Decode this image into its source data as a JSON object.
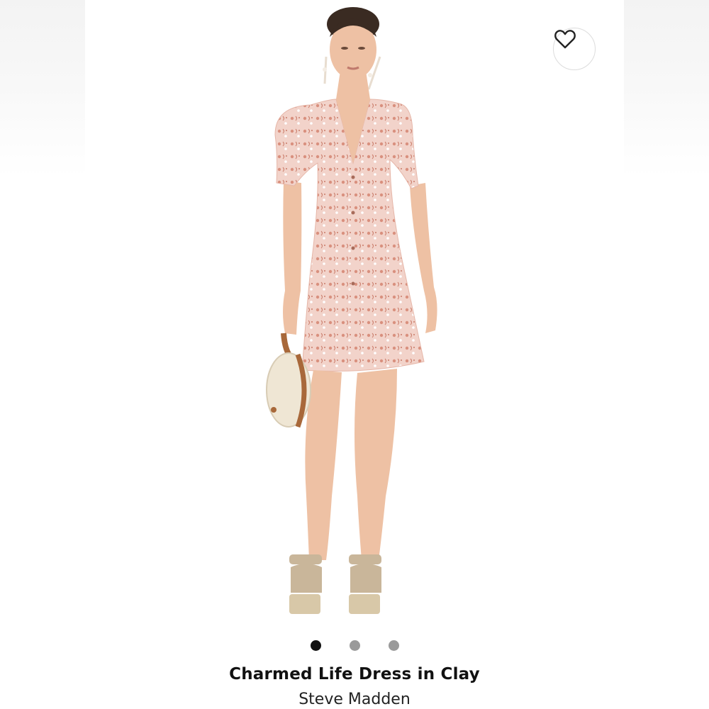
{
  "product": {
    "name": "Charmed Life Dress in Clay",
    "brand": "Steve Madden",
    "favorite_icon": "heart-outline-icon"
  },
  "gallery": {
    "image_count": 3,
    "active_index": 0
  },
  "colors": {
    "dress": "#f0cdc3",
    "skin": "#efc2a6",
    "bag": "#efe6d4",
    "bag_strap": "#a8683a",
    "active_dot": "#111111",
    "inactive_dot": "#9a9a9a"
  }
}
